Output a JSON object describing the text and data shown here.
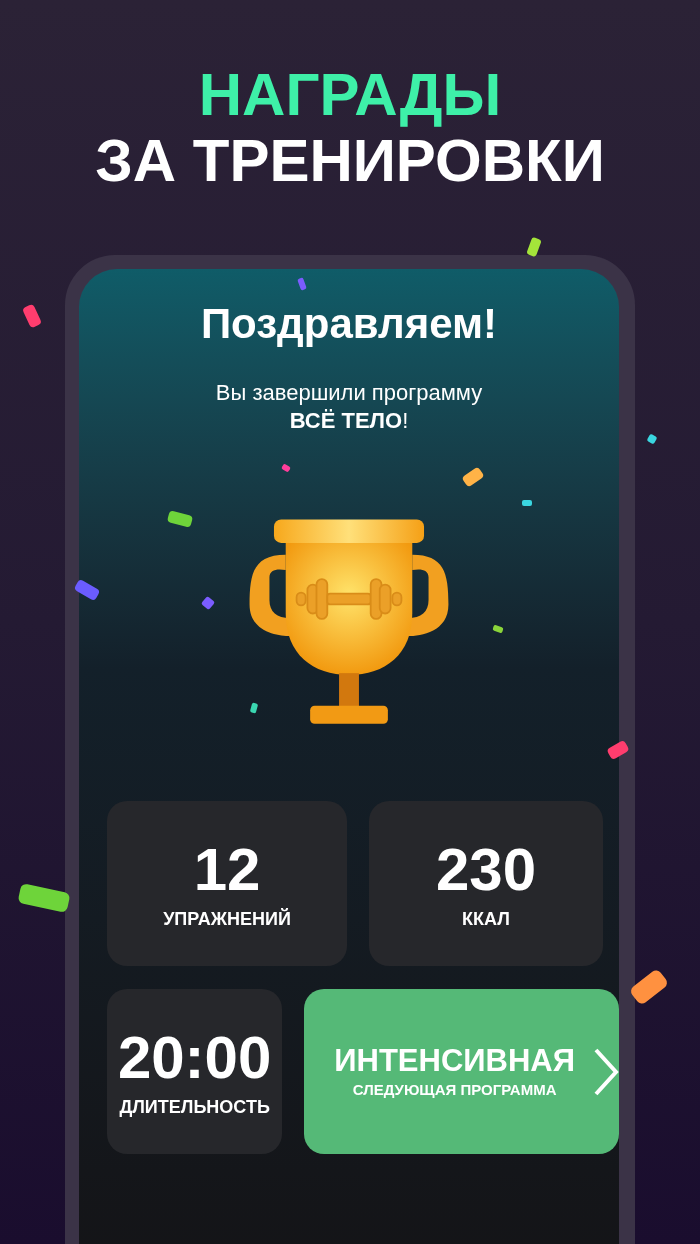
{
  "headline": {
    "line_1": "НАГРАДЫ",
    "line_2": "ЗА ТРЕНИРОВКИ"
  },
  "screen": {
    "title": "Поздравляем!",
    "message": "Вы завершили программу\n**ВСЁ ТЕЛО**!",
    "stats": [
      {
        "value": "12",
        "label": "УПРАЖНЕНИЙ"
      },
      {
        "value": "230",
        "label": "ККАЛ"
      },
      {
        "value": "20:00",
        "label": "ДЛИТЕЛЬНОСТЬ"
      }
    ],
    "next_program": {
      "name": "ИНТЕНСИВНАЯ",
      "caption": "СЛЕДУЮЩАЯ ПРОГРАММА"
    }
  }
}
